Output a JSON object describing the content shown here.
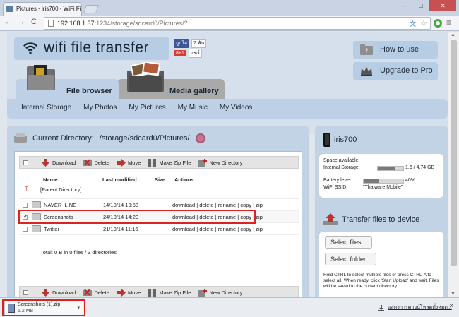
{
  "browser": {
    "tab_title": "Pictures - iris700 - WiFi Fi",
    "tab_close": "×",
    "url_host": "192.168.1.37",
    "url_rest": ":1234/storage/sdcard0/Pictures/?",
    "nav_back": "←",
    "nav_forward": "→",
    "nav_reload": "C",
    "star": "☆",
    "menu": "≡",
    "win_min": "–",
    "win_max": "□",
    "win_close": "✕"
  },
  "header": {
    "logo_text": "wifi file transfer",
    "fb_like": "ถูกใจ",
    "fb_count": "7 พัน",
    "gplus": "8+1",
    "gplus_count": "แชร์",
    "how_to_use": "How to use",
    "upgrade": "Upgrade to Pro"
  },
  "tabs": {
    "file_browser": "File browser",
    "media_gallery": "Media gallery"
  },
  "subnav": [
    "Internal Storage",
    "My Photos",
    "My Pictures",
    "My Music",
    "My Videos"
  ],
  "main": {
    "curdir_label": "Current Directory:",
    "curdir_path": "/storage/sdcard0/Pictures/",
    "actions": {
      "download": "Download",
      "delete": "Delete",
      "move": "Move",
      "zip": "Make Zip File",
      "newdir": "New Directory"
    },
    "columns": {
      "name": "Name",
      "modified": "Last modified",
      "size": "Size",
      "actions": "Actions"
    },
    "parent": "[Parent Directory]",
    "rows": [
      {
        "name": "NAVER_LINE",
        "modified": "14/10/14 19:53",
        "size": "-",
        "actions": "download | delete | rename | copy | zip"
      },
      {
        "name": "Screenshots",
        "modified": "24/10/14 14:20",
        "size": "-",
        "actions": "download | delete | rename | copy | zip"
      },
      {
        "name": "Twitter",
        "modified": "21/10/14 11:16",
        "size": "-",
        "actions": "download | delete | rename | copy | zip"
      }
    ],
    "total": "Total: 0 B in 0 files / 3 directories"
  },
  "device": {
    "name": "iris700",
    "space_available": "Space available",
    "internal_label": "Internal Storage:",
    "internal_value": "1.6 / 4.74 GB",
    "internal_used_fraction": 0.66,
    "battery_label": "Battery level:",
    "battery_value": "40%",
    "battery_fraction": 0.4,
    "ssid_label": "WiFi SSID:",
    "ssid_value": "\"Thaiware Mobile\""
  },
  "transfer": {
    "title": "Transfer files to device",
    "select_files": "Select files...",
    "select_folder": "Select folder...",
    "note": "Hold CTRL to select multiple files or press CTRL-A to select all. When ready, click 'Start Upload' and wait. Files will be saved to the current directory."
  },
  "download": {
    "file_name": "Screenshots (1).zip",
    "file_size": "5.2 MB",
    "show_all": "แสดงการดาวน์โหลดทั้งหมด...",
    "close": "✕"
  },
  "colors": {
    "accent": "#bed0e6",
    "panel": "#c3d3e6",
    "highlight": "#dd2222"
  }
}
